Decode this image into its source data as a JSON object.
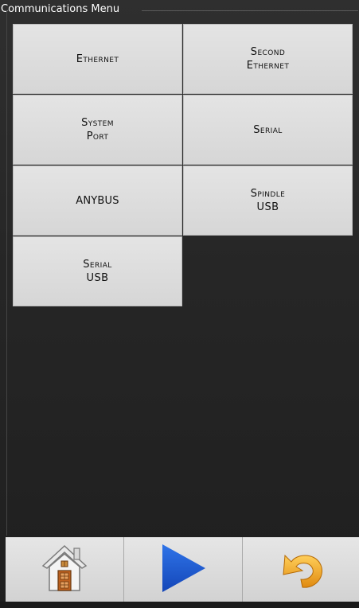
{
  "window": {
    "title": "Communications Menu"
  },
  "menu": {
    "buttons": [
      {
        "label": "Ethernet",
        "style": "small-caps"
      },
      {
        "label": "Second\nEthernet",
        "style": "small-caps"
      },
      {
        "label": "System\nPort",
        "style": "small-caps"
      },
      {
        "label": "Serial",
        "style": "small-caps"
      },
      {
        "label": "ANYBUS",
        "style": "plain"
      },
      {
        "label": "Spindle\nUSB",
        "style": "small-caps"
      },
      {
        "label": "Serial\nUSB",
        "style": "small-caps"
      }
    ]
  },
  "navbar": {
    "items": [
      {
        "icon": "home-icon"
      },
      {
        "icon": "play-icon"
      },
      {
        "icon": "undo-icon"
      }
    ]
  },
  "colors": {
    "play_blue": "#1f5fd6",
    "undo_orange": "#f2a322",
    "house_brown": "#8b4a1c"
  }
}
